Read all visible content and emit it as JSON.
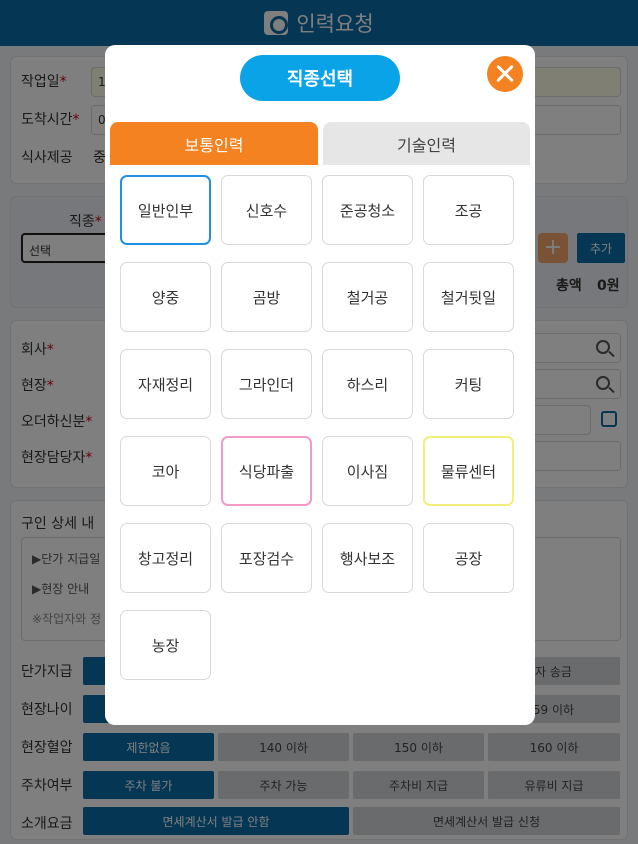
{
  "header": {
    "title": "인력요청"
  },
  "form": {
    "work_date_label": "작업일",
    "work_date_value": "1",
    "arrival_label": "도착시간",
    "arrival_value": "0",
    "meal_label": "식사제공",
    "meal_value": "중",
    "job_label": "직종",
    "job_placeholder": "선택",
    "add_label": "추가",
    "total_label": "총액",
    "total_value": "0원",
    "company_label": "회사",
    "site_label": "현장",
    "ordered_by_label": "오더하신분",
    "site_manager_label": "현장담당자",
    "detail_title": "구인 상세 내",
    "detail_lines": [
      "▶단가 지급일",
      "▶현장 안내",
      "※작업자와 정"
    ],
    "pay_label": "단가지급",
    "pay_option": "자 송금",
    "age_label": "현장나이",
    "age_option": "59 이하",
    "bp_label": "현장혈압",
    "bp_options": [
      "제한없음",
      "140 이하",
      "150 이하",
      "160 이하"
    ],
    "parking_label": "주차여부",
    "parking_options": [
      "주차 불가",
      "주차 가능",
      "주차비 지급",
      "유류비 지급"
    ],
    "fee_label": "소개요금",
    "fee_options": [
      "면세계산서 발급 안함",
      "면세계산서 발급 신청"
    ]
  },
  "modal": {
    "title": "직종선택",
    "tabs": [
      "보통인력",
      "기술인력"
    ],
    "jobs": [
      "일반인부",
      "신호수",
      "준공청소",
      "조공",
      "양중",
      "곰방",
      "철거공",
      "철거뒷일",
      "자재정리",
      "그라인더",
      "하스리",
      "커팅",
      "코아",
      "식당파출",
      "이사짐",
      "물류센터",
      "창고정리",
      "포장검수",
      "행사보조",
      "공장",
      "농장"
    ]
  }
}
